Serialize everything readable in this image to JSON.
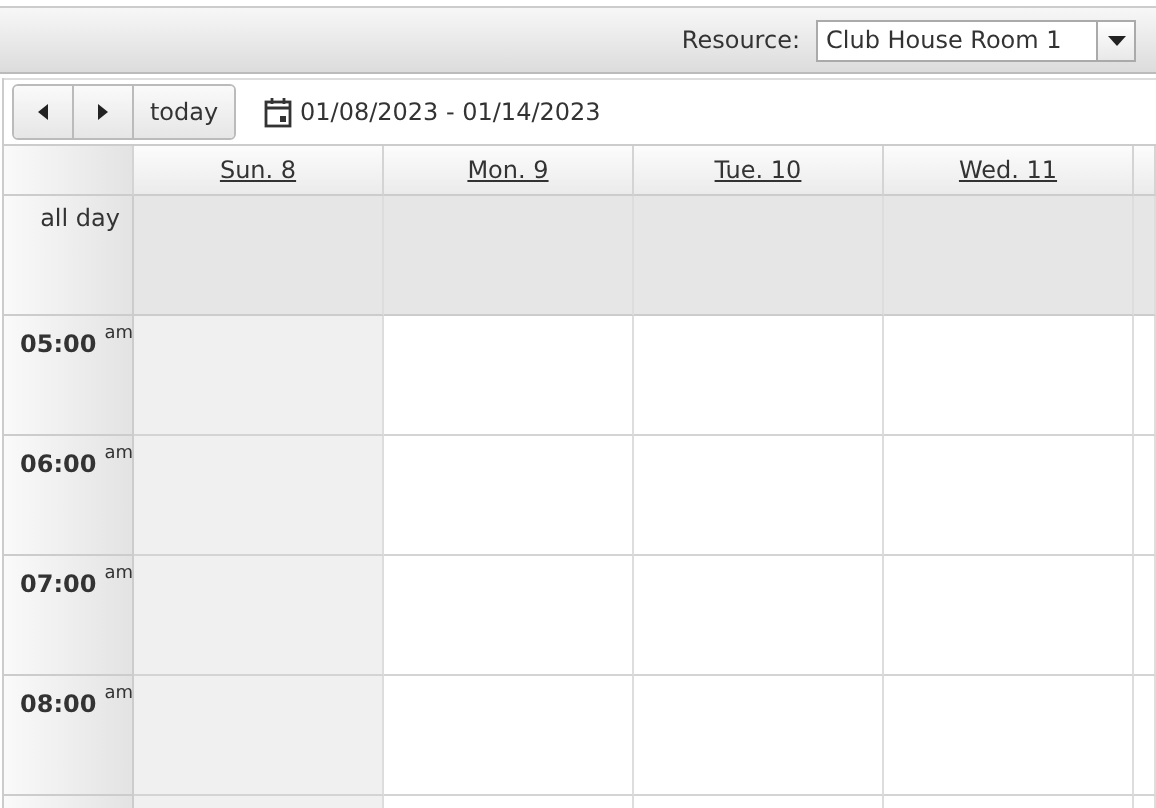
{
  "toolbar": {
    "resource_label": "Resource:",
    "resource_value": "Club House Room 1"
  },
  "nav": {
    "today": "today",
    "range": "01/08/2023 - 01/14/2023"
  },
  "all_day_label": "all day",
  "days": [
    {
      "label": "Sun. 8",
      "weekend": true
    },
    {
      "label": "Mon. 9",
      "weekend": false
    },
    {
      "label": "Tue. 10",
      "weekend": false
    },
    {
      "label": "Wed. 11",
      "weekend": false
    }
  ],
  "hours": [
    {
      "time": "05:00",
      "meridiem": "am"
    },
    {
      "time": "06:00",
      "meridiem": "am"
    },
    {
      "time": "07:00",
      "meridiem": "am"
    },
    {
      "time": "08:00",
      "meridiem": "am"
    }
  ]
}
